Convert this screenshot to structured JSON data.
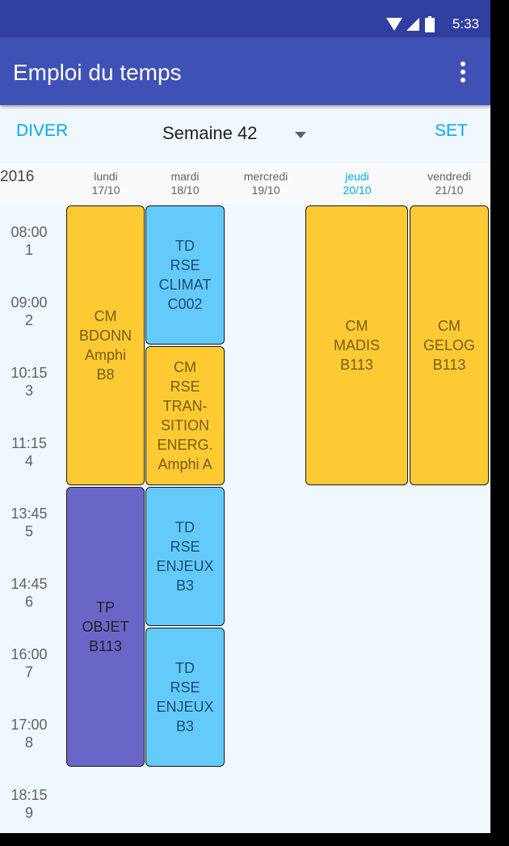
{
  "status_bar": {
    "time": "5:33",
    "icons": [
      "wifi-icon",
      "cell-signal-icon",
      "battery-icon"
    ]
  },
  "app_bar": {
    "title": "Emploi du temps",
    "menu_icon": "more-vert-icon"
  },
  "controls": {
    "prev_label": "DIVER",
    "next_label": "SET",
    "week_label": "Semaine 42",
    "dropdown_icon": "dropdown-arrow-icon"
  },
  "header": {
    "year": "2016",
    "days": [
      {
        "name": "lundi",
        "date": "17/10"
      },
      {
        "name": "mardi",
        "date": "18/10"
      },
      {
        "name": "mercredi",
        "date": "19/10"
      },
      {
        "name": "jeudi",
        "date": "20/10"
      },
      {
        "name": "vendredi",
        "date": "21/10"
      }
    ]
  },
  "time_slots": [
    {
      "time": "08:00",
      "num": "1"
    },
    {
      "time": "09:00",
      "num": "2"
    },
    {
      "time": "10:15",
      "num": "3"
    },
    {
      "time": "11:15",
      "num": "4"
    },
    {
      "time": "13:45",
      "num": "5"
    },
    {
      "time": "14:45",
      "num": "6"
    },
    {
      "time": "16:00",
      "num": "7"
    },
    {
      "time": "17:00",
      "num": "8"
    },
    {
      "time": "18:15",
      "num": "9"
    }
  ],
  "events": [
    {
      "lines": [
        "CM",
        "BDONN",
        "Amphi",
        "B8"
      ]
    },
    {
      "lines": [
        "TP",
        "OBJET",
        "B113"
      ]
    },
    {
      "lines": [
        "TD",
        "RSE",
        "CLIMAT",
        "C002"
      ]
    },
    {
      "lines": [
        "CM",
        "RSE",
        "TRAN-",
        "SITION",
        "ENERG.",
        "Amphi A"
      ]
    },
    {
      "lines": [
        "TD",
        "RSE",
        "ENJEUX",
        "B3"
      ]
    },
    {
      "lines": [
        "TD",
        "RSE",
        "ENJEUX",
        "B3"
      ]
    },
    {
      "lines": [
        "CM",
        "MADIS",
        "B113"
      ]
    },
    {
      "lines": [
        "CM",
        "GELOG",
        "B113"
      ]
    }
  ],
  "colors": {
    "primary": "#3f51b5",
    "primary_dark": "#303f9f",
    "accent": "#03a9f4",
    "cm": "#fdca34",
    "td": "#63caf9",
    "tp": "#6966c8"
  }
}
